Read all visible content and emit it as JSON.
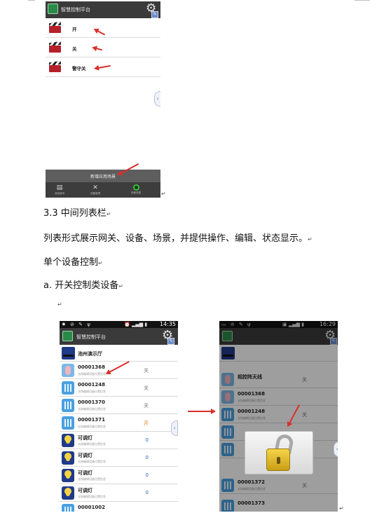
{
  "phone1": {
    "app_title": "智慧控制平台",
    "scenes": [
      "开",
      "关",
      "警守关"
    ],
    "add_button": "新增应用场景",
    "nav": [
      "添加房间",
      "设备管理",
      "场景设置"
    ],
    "side_tab": "‹"
  },
  "doc": {
    "heading": "3.3 中间列表栏",
    "para": "列表形式展示网关、设备、场景，并提供操作、编辑、状态显示。",
    "subheading": "单个设备控制",
    "item_a": "a.  开关控制类设备",
    "return_mark": "↵"
  },
  "phone2": {
    "status_time": "14:35",
    "app_title": "智慧控制平台",
    "room": "池州演示厅",
    "hint": "长按编辑设备位置信息",
    "devices": [
      {
        "name": "00001368",
        "state": "关"
      },
      {
        "name": "00001248",
        "state": "关"
      },
      {
        "name": "00001370",
        "state": "关"
      },
      {
        "name": "00001371",
        "state": "开"
      },
      {
        "name": "可调灯",
        "state": "0"
      },
      {
        "name": "可调灯",
        "state": "0"
      },
      {
        "name": "可调灯",
        "state": "0"
      },
      {
        "name": "可调灯",
        "state": "0"
      },
      {
        "name": "00001002",
        "state": ""
      }
    ]
  },
  "phone3": {
    "status_time": "16:29",
    "devices": [
      {
        "name": "相控阵天线",
        "state": "关"
      },
      {
        "name": "00001368",
        "state": ""
      },
      {
        "name": "00001248",
        "state": "关"
      },
      {
        "name": "",
        "state": ""
      },
      {
        "name": "",
        "state": ""
      },
      {
        "name": "00001372",
        "state": "关"
      },
      {
        "name": "00001373",
        "state": ""
      }
    ]
  },
  "colors": {
    "arrow": "#d9302a",
    "bar_dark": "#3a3a3a",
    "state_on": "#e07a1e",
    "state_value": "#2a5fb0"
  }
}
